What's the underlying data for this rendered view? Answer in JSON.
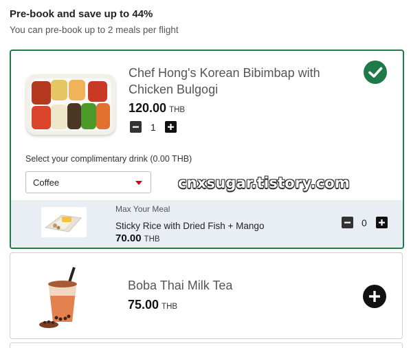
{
  "header": {
    "title": "Pre-book and save up to 44%",
    "subtitle": "You can pre-book up to 2 meals per flight"
  },
  "meal": {
    "name": "Chef Hong's Korean Bibimbap with Chicken Bulgogi",
    "price": "120.00",
    "currency": "THB",
    "quantity": "1",
    "selected": true,
    "image_icon": "bibimbap-meal-photo"
  },
  "drink": {
    "label": "Select your complimentary drink (0.00 THB)",
    "selected": "Coffee"
  },
  "addon": {
    "tag": "Max Your Meal",
    "name": "Sticky Rice with Dried Fish + Mango",
    "price": "70.00",
    "currency": "THB",
    "quantity": "0",
    "image_icon": "sticky-rice-photo"
  },
  "boba": {
    "name": "Boba Thai Milk Tea",
    "price": "75.00",
    "currency": "THB",
    "image_icon": "boba-tea-photo"
  },
  "watermark": "cnxsugar.tistory.com",
  "colors": {
    "accent_green": "#1f7a4a",
    "caret_red": "#d0021b",
    "addon_bg": "#e9edf4"
  }
}
